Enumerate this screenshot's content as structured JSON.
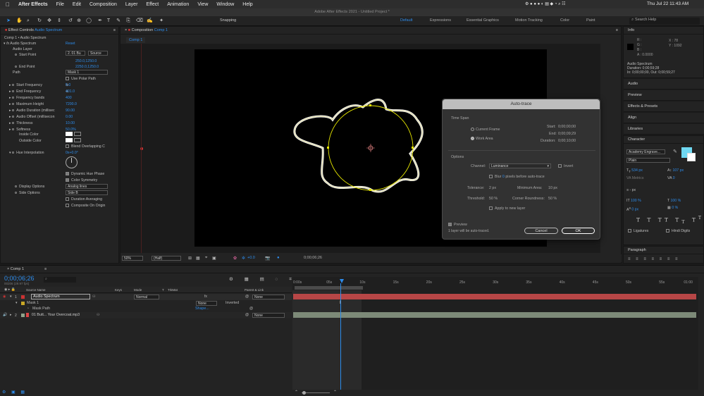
{
  "menubar": {
    "apple": "",
    "app": "After Effects",
    "items": [
      "File",
      "Edit",
      "Composition",
      "Layer",
      "Effect",
      "Animation",
      "View",
      "Window",
      "Help"
    ],
    "clock": "Thu Jul 22  11:43 AM"
  },
  "title": "Adobe After Effects 2021 - Untitled Project *",
  "toolbar": {
    "snapping": "Snapping",
    "workspaces": [
      "Default",
      "Expressions",
      "Essential Graphics",
      "Motion Tracking",
      "Color",
      "Paint"
    ],
    "search_placeholder": "Search Help"
  },
  "effect_controls": {
    "tab": "Effect Controls",
    "tab_target": "Audio Spectrum",
    "breadcrumb": "Comp 1 • Audio Spectrum",
    "effect_name": "Audio Spectrum",
    "reset": "Reset",
    "audio_layer_label": "Audio Layer",
    "audio_layer_value": "2. 01 Bu",
    "audio_layer_source": "Source",
    "start_point_label": "Start Point",
    "start_point_value": "250.0,1250.0",
    "end_point_label": "End Point",
    "end_point_value": "2250.0,1250.0",
    "path_label": "Path",
    "path_value": "Mask 1",
    "use_polar": "Use Polar Path",
    "params": [
      {
        "label": "Start Frequency",
        "value": "5.0"
      },
      {
        "label": "End Frequency",
        "value": "401.0"
      },
      {
        "label": "Frequency bands",
        "value": "400"
      },
      {
        "label": "Maximum Height",
        "value": "7200.0"
      },
      {
        "label": "Audio Duration (millisec",
        "value": "90.00"
      },
      {
        "label": "Audio Offset (millisecon",
        "value": "0.00"
      },
      {
        "label": "Thickness",
        "value": "10.00"
      },
      {
        "label": "Softness",
        "value": "50.0%"
      }
    ],
    "inside_color": "Inside Color",
    "outside_color": "Outside Color",
    "blend": "Blend Overlapping C",
    "hue_label": "Hue Interpolation",
    "hue_value": "0x+0.0°",
    "dynamic_hue": "Dynamic Hue Phase",
    "color_symmetry": "Color Symmetry",
    "display_options": "Display Options",
    "display_value": "Analog lines",
    "side_options": "Side Options",
    "side_value": "Side B",
    "duration_avg": "Duration Averaging",
    "composite": "Composite On Origin"
  },
  "composition": {
    "tab": "Composition",
    "tab_target": "Comp 1",
    "subtab": "Comp 1",
    "zoom": "50%",
    "quality": "(Half)",
    "exposure": "+0.0",
    "timecode": "0;00;06;26"
  },
  "autotrace": {
    "title": "Auto-trace",
    "time_span": "Time Span",
    "current_frame": "Current Frame",
    "work_area": "Work Area",
    "start_label": "Start:",
    "start": "0;00;00;00",
    "end_label": "End:",
    "end": "0;00;09;29",
    "duration_label": "Duration:",
    "duration": "0;00;10;00",
    "options": "Options",
    "channel_label": "Channel:",
    "channel": "Luminance",
    "invert": "Invert",
    "blur_prefix": "Blur",
    "blur_value": "0",
    "blur_suffix": "pixels before auto-trace",
    "tolerance_label": "Tolerance:",
    "tolerance": "2 px",
    "min_area_label": "Minimum Area:",
    "min_area": "10 px",
    "threshold_label": "Threshold:",
    "threshold": "50 %",
    "corner_label": "Corner Roundness:",
    "corner": "50 %",
    "apply_new": "Apply to new layer",
    "preview": "Preview",
    "status": "1 layer will be auto-traced.",
    "cancel": "Cancel",
    "ok": "OK"
  },
  "info": {
    "title": "Info",
    "r": "R :",
    "g": "G :",
    "b": "B :",
    "a": "A : 0.0000",
    "x": "X : 78",
    "y": "Y : 1092",
    "layer": "Audio Spectrum",
    "duration": "Duration: 0;00;59;28",
    "inout": "In: 0;00;00;00, Out: 0;00;59;27"
  },
  "right_panels": [
    "Audio",
    "Preview",
    "Effects & Presets",
    "Align",
    "Libraries"
  ],
  "character": {
    "title": "Character",
    "font": "Academy Engrave...",
    "style": "Plain",
    "size": "534 px",
    "leading": "107 px",
    "kerning": "Metrics",
    "tracking": "0",
    "stroke_unit": "- px",
    "vscale": "100 %",
    "hscale": "100 %",
    "baseline": "0 px",
    "tsume": "0 %",
    "ligatures": "Ligatures",
    "hindi": "Hindi Digits",
    "fill_color": "#6fd8f2"
  },
  "paragraph": {
    "title": "Paragraph"
  },
  "timeline": {
    "tab": "Comp 1",
    "timecode": "0;00;06;26",
    "fps": "00206 (29.97 fps)",
    "columns": [
      "Source Name",
      "Keys",
      "Mode",
      "T",
      "TrkMat",
      "Parent & Link"
    ],
    "layers": [
      {
        "num": "1",
        "name": "Audio Spectrum",
        "mode": "Normal",
        "parent": "None"
      },
      {
        "num": "",
        "name": "Mask 1",
        "mode": "None",
        "parent": "Inverted"
      },
      {
        "num": "",
        "name": "Mask Path",
        "mode": "Shape...",
        "parent": ""
      },
      {
        "num": "2",
        "name": "01 Butt... Your Overcoat.mp3",
        "mode": "",
        "parent": "None"
      }
    ],
    "ruler": [
      "0:00s",
      "05s",
      "10s",
      "15s",
      "20s",
      "25s",
      "30s",
      "35s",
      "40s",
      "45s",
      "50s",
      "55s",
      "01:00"
    ]
  }
}
